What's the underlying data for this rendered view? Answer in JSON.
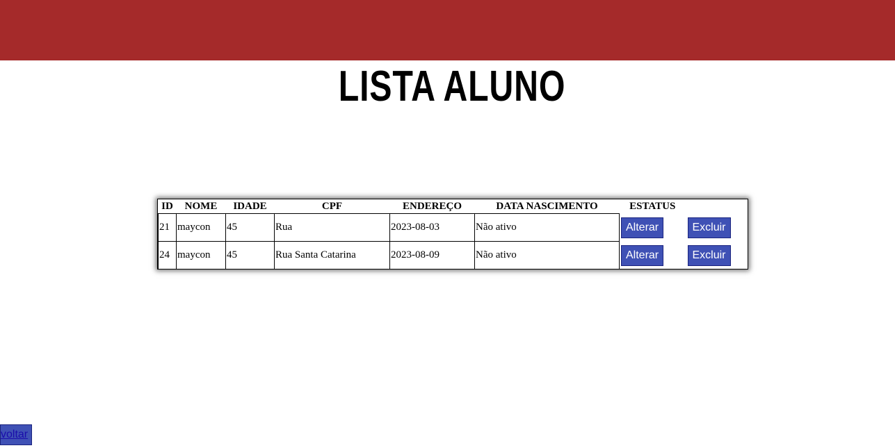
{
  "page": {
    "title": "LISTA ALUNO"
  },
  "table": {
    "headers": [
      "ID",
      "NOME",
      "IDADE",
      "CPF",
      "ENDEREÇO",
      "DATA NASCIMENTO",
      "ESTATUS"
    ],
    "rows": [
      {
        "id": "21",
        "nome": "maycon",
        "idade": "45",
        "cpf": "Rua",
        "endereco": "2023-08-03",
        "data_nascimento": "Não ativo",
        "alterar": "Alterar",
        "excluir": "Excluir"
      },
      {
        "id": "24",
        "nome": "maycon",
        "idade": "45",
        "cpf": "Rua Santa Catarina",
        "endereco": "2023-08-09",
        "data_nascimento": "Não ativo",
        "alterar": "Alterar",
        "excluir": "Excluir"
      }
    ]
  },
  "footer": {
    "back_label": "voltar"
  },
  "colors": {
    "header_bar": "#a52a2a",
    "button": "#3f51b5"
  }
}
